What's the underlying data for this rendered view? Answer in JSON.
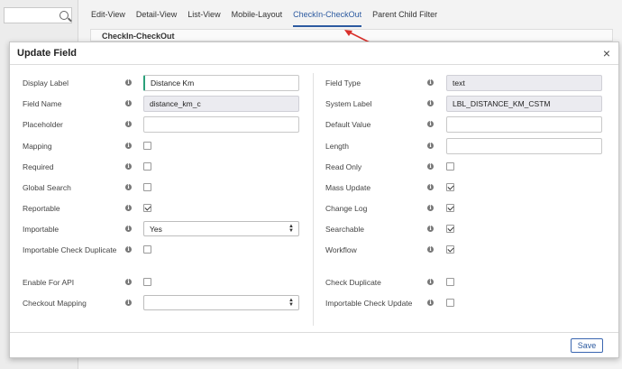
{
  "tabs": [
    "Edit-View",
    "Detail-View",
    "List-View",
    "Mobile-Layout",
    "CheckIn-CheckOut",
    "Parent Child Filter"
  ],
  "active_tab": 4,
  "panel_title": "CheckIn-CheckOut",
  "modal": {
    "title": "Update Field",
    "close_label": "×",
    "save_label": "Save"
  },
  "left_fields": [
    {
      "label": "Display Label",
      "type": "input",
      "value": "Distance Km",
      "focused": true
    },
    {
      "label": "Field Name",
      "type": "readonly",
      "value": "distance_km_c"
    },
    {
      "label": "Placeholder",
      "type": "input",
      "value": ""
    },
    {
      "label": "Mapping",
      "type": "checkbox",
      "checked": false
    },
    {
      "label": "Required",
      "type": "checkbox",
      "checked": false
    },
    {
      "label": "Global Search",
      "type": "checkbox",
      "checked": false
    },
    {
      "label": "Reportable",
      "type": "checkbox",
      "checked": true
    },
    {
      "label": "Importable",
      "type": "select",
      "value": "Yes"
    },
    {
      "label": "Importable Check Duplicate",
      "type": "checkbox",
      "checked": false
    },
    {
      "label": "Enable For API",
      "type": "checkbox",
      "checked": false
    },
    {
      "label": "Checkout Mapping",
      "type": "select",
      "value": ""
    }
  ],
  "right_fields": [
    {
      "label": "Field Type",
      "type": "readonly",
      "value": "text"
    },
    {
      "label": "System Label",
      "type": "readonly",
      "value": "LBL_DISTANCE_KM_CSTM"
    },
    {
      "label": "Default Value",
      "type": "input",
      "value": ""
    },
    {
      "label": "Length",
      "type": "input",
      "value": ""
    },
    {
      "label": "Read Only",
      "type": "checkbox",
      "checked": false
    },
    {
      "label": "Mass Update",
      "type": "checkbox",
      "checked": true
    },
    {
      "label": "Change Log",
      "type": "checkbox",
      "checked": true
    },
    {
      "label": "Searchable",
      "type": "checkbox",
      "checked": true
    },
    {
      "label": "Workflow",
      "type": "checkbox",
      "checked": true
    },
    {
      "label": "Check Duplicate",
      "type": "checkbox",
      "checked": false
    },
    {
      "label": "Importable Check Update",
      "type": "checkbox",
      "checked": false
    }
  ],
  "colors": {
    "accent": "#2c5aa0",
    "focus": "#2aa07a",
    "arrow": "#d9302b"
  }
}
